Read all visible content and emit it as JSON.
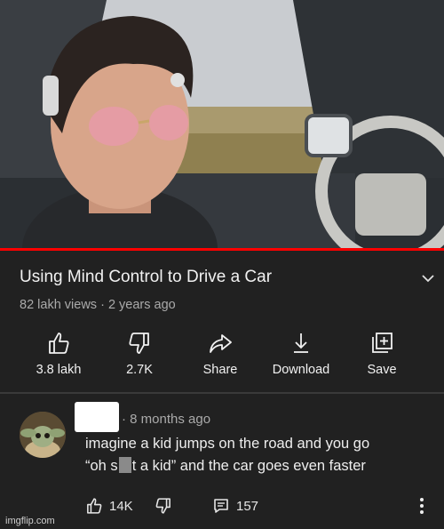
{
  "video": {
    "title": "Using Mind Control to Drive a Car",
    "views": "82 lakh views",
    "separator": " · ",
    "age": "2 years ago",
    "progress": 1.0,
    "accent": "#ff0000"
  },
  "actions": [
    {
      "icon": "thumbs-up-icon",
      "label": "3.8 lakh"
    },
    {
      "icon": "thumbs-down-icon",
      "label": "2.7K"
    },
    {
      "icon": "share-icon",
      "label": "Share"
    },
    {
      "icon": "download-icon",
      "label": "Download"
    },
    {
      "icon": "save-to-playlist-icon",
      "label": "Save"
    }
  ],
  "comment": {
    "age": "8 months ago",
    "bullet": "·",
    "line1": "imagine a kid jumps on the road and you go",
    "line2_part1": "“oh s",
    "line2_part2": "t a kid” and the car goes even faster",
    "likes": "14K",
    "replies": "157"
  },
  "watermark": "imgflip.com"
}
